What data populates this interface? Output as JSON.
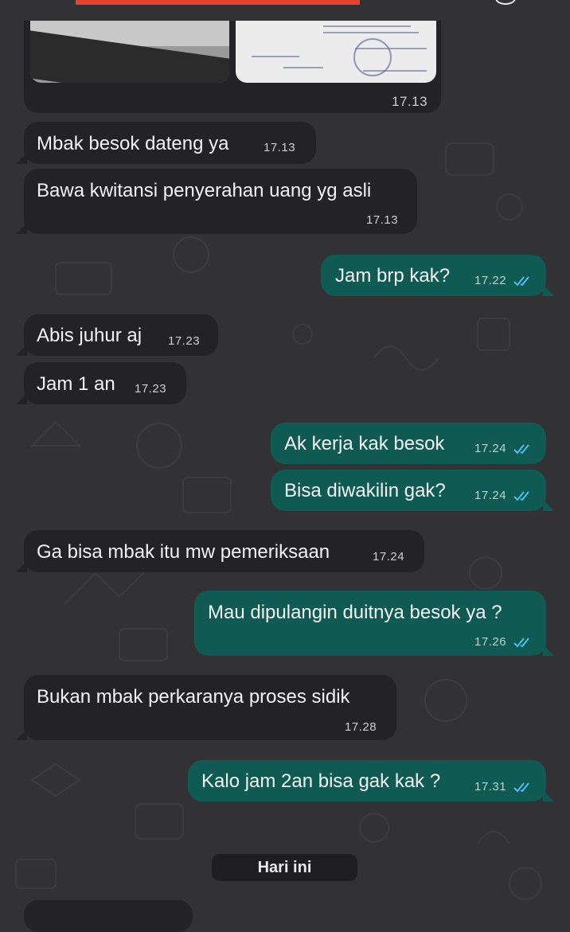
{
  "chat": {
    "image_message": {
      "time": "17.13"
    },
    "messages": [
      {
        "text": "Mbak besok dateng ya",
        "time": "17.13"
      },
      {
        "text": "Bawa kwitansi penyerahan uang yg asli",
        "time": "17.13"
      },
      {
        "text": "Jam brp kak?",
        "time": "17.22"
      },
      {
        "text": "Abis juhur aj",
        "time": "17.23"
      },
      {
        "text": "Jam 1 an",
        "time": "17.23"
      },
      {
        "text": "Ak kerja kak besok",
        "time": "17.24"
      },
      {
        "text": "Bisa diwakilin gak?",
        "time": "17.24"
      },
      {
        "text": "Ga bisa mbak itu mw pemeriksaan",
        "time": "17.24"
      },
      {
        "text": "Mau dipulangin duitnya besok ya ?",
        "time": "17.26"
      },
      {
        "text": "Bukan mbak perkaranya proses sidik",
        "time": "17.28"
      },
      {
        "text": "Kalo jam 2an bisa gak kak ?",
        "time": "17.31"
      }
    ],
    "date_separator": "Hari ini"
  },
  "colors": {
    "background": "#323235",
    "incoming_bubble": "#232325",
    "outgoing_bubble": "#0f5a52",
    "read_ticks": "#53bdeb",
    "top_bar_accent": "#e5412b"
  },
  "icons": {
    "read_receipt": "double-check-icon",
    "status_indicator": "check-icon"
  }
}
